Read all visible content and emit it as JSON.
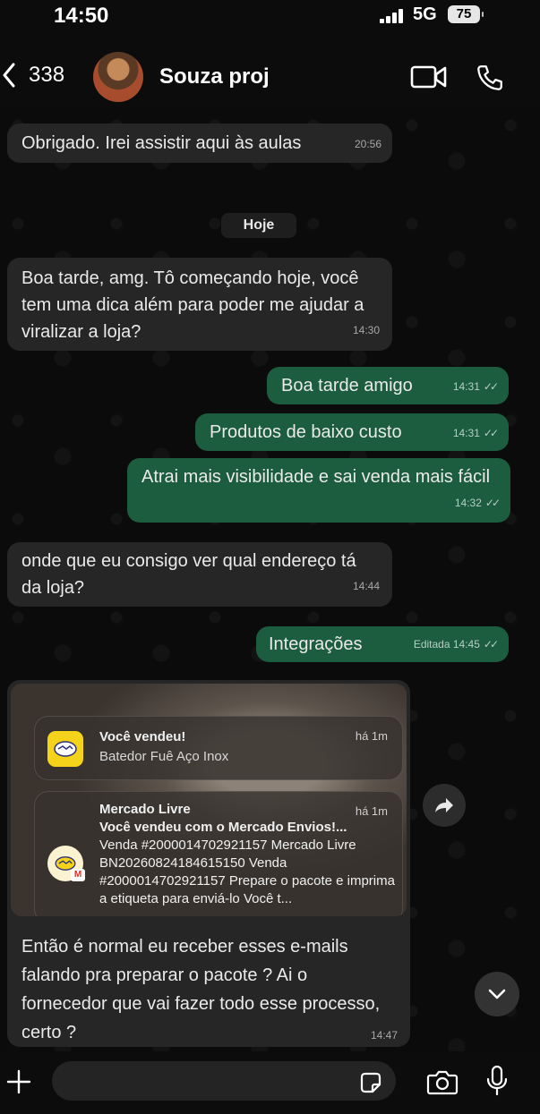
{
  "status_bar": {
    "time": "14:50",
    "network": "5G",
    "battery": "75"
  },
  "header": {
    "back_count": "338",
    "contact_name": "Souza proj"
  },
  "date_separator": "Hoje",
  "messages": [
    {
      "dir": "in",
      "text": "Obrigado. Irei assistir aqui às aulas",
      "time": "20:56"
    },
    {
      "dir": "in",
      "text": "Boa tarde, amg. Tô começando hoje, você tem uma dica além para poder me ajudar a viralizar a loja?",
      "time": "14:30"
    },
    {
      "dir": "out",
      "text": "Boa tarde amigo",
      "time": "14:31"
    },
    {
      "dir": "out",
      "text": "Produtos de baixo custo",
      "time": "14:31"
    },
    {
      "dir": "out",
      "text": "Atrai mais visibilidade e sai venda mais fácil",
      "time": "14:32"
    },
    {
      "dir": "in",
      "text": "onde que eu consigo ver qual endereço tá da loja?",
      "time": "14:44"
    },
    {
      "dir": "out",
      "text": "Integrações",
      "edited_label": "Editada",
      "time": "14:45"
    }
  ],
  "media_message": {
    "notification_1": {
      "title": "Você vendeu!",
      "subtitle": "Batedor Fuê Aço Inox",
      "time": "há 1m"
    },
    "notification_2": {
      "app": "Mercado Livre",
      "time": "há 1m",
      "headline": "Você vendeu com o Mercado Envios!...",
      "body": "Venda #2000014702921157 Mercado Livre BN20260824184615150 Venda #2000014702921157 Prepare o pacote e imprima a etiqueta para enviá-lo Você t..."
    },
    "caption": "Então é normal eu receber esses e-mails falando pra preparar o pacote ? Ai o fornecedor que vai fazer todo esse processo, certo ?",
    "time": "14:47"
  },
  "input": {
    "placeholder": ""
  },
  "colors": {
    "outgoing_bubble": "#1c5c3f",
    "incoming_bubble": "#262626",
    "background": "#0b0b0b"
  }
}
